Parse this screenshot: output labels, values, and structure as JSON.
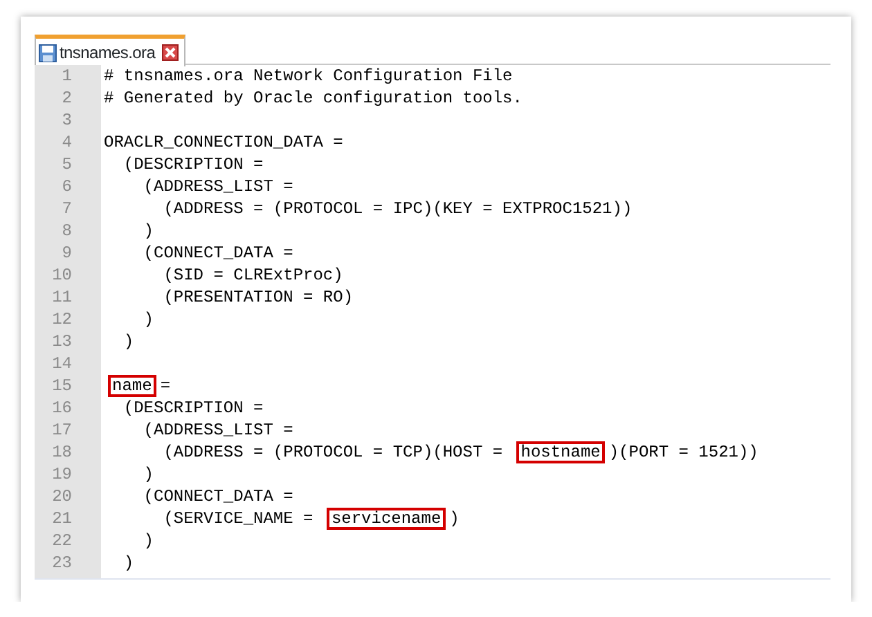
{
  "tabs": [
    {
      "label": "tnsnames.ora",
      "selected": true
    }
  ],
  "lines": [
    {
      "number": "1",
      "segments": [
        {
          "text": "# tnsnames.ora Network Configuration File",
          "boxed": false
        }
      ]
    },
    {
      "number": "2",
      "segments": [
        {
          "text": "# Generated by Oracle configuration tools.",
          "boxed": false
        }
      ]
    },
    {
      "number": "3"
    },
    {
      "number": "4",
      "segments": [
        {
          "text": "ORACLR_CONNECTION_DATA =",
          "boxed": false
        }
      ]
    },
    {
      "number": "5",
      "segments": [
        {
          "text": "  (DESCRIPTION =",
          "boxed": false
        }
      ]
    },
    {
      "number": "6",
      "segments": [
        {
          "text": "    (ADDRESS_LIST =",
          "boxed": false
        }
      ]
    },
    {
      "number": "7",
      "segments": [
        {
          "text": "      (ADDRESS = (PROTOCOL = IPC)(KEY = EXTPROC1521))",
          "boxed": false
        }
      ]
    },
    {
      "number": "8",
      "segments": [
        {
          "text": "    )",
          "boxed": false
        }
      ]
    },
    {
      "number": "9",
      "segments": [
        {
          "text": "    (CONNECT_DATA =",
          "boxed": false
        }
      ]
    },
    {
      "number": "10",
      "segments": [
        {
          "text": "      (SID = CLRExtProc)",
          "boxed": false
        }
      ]
    },
    {
      "number": "11",
      "segments": [
        {
          "text": "      (PRESENTATION = RO)",
          "boxed": false
        }
      ]
    },
    {
      "number": "12",
      "segments": [
        {
          "text": "    )",
          "boxed": false
        }
      ]
    },
    {
      "number": "13",
      "segments": [
        {
          "text": "  )",
          "boxed": false
        }
      ]
    },
    {
      "number": "14"
    },
    {
      "number": "15",
      "segments": [
        {
          "text": "name",
          "boxed": true
        },
        {
          "text": "=",
          "boxed": false
        }
      ]
    },
    {
      "number": "16",
      "segments": [
        {
          "text": "  (DESCRIPTION =",
          "boxed": false
        }
      ]
    },
    {
      "number": "17",
      "segments": [
        {
          "text": "    (ADDRESS_LIST =",
          "boxed": false
        }
      ]
    },
    {
      "number": "18",
      "segments": [
        {
          "text": "      (ADDRESS = (PROTOCOL = TCP)(HOST = ",
          "boxed": false
        },
        {
          "text": "hostname",
          "boxed": true
        },
        {
          "text": ")(PORT = 1521))",
          "boxed": false
        }
      ]
    },
    {
      "number": "19",
      "segments": [
        {
          "text": "    )",
          "boxed": false
        }
      ]
    },
    {
      "number": "20",
      "segments": [
        {
          "text": "    (CONNECT_DATA =",
          "boxed": false
        }
      ]
    },
    {
      "number": "21",
      "segments": [
        {
          "text": "      (SERVICE_NAME = ",
          "boxed": false
        },
        {
          "text": "servicename",
          "boxed": true
        },
        {
          "text": ")",
          "boxed": false
        }
      ]
    },
    {
      "number": "22",
      "segments": [
        {
          "text": "    )",
          "boxed": false
        }
      ]
    },
    {
      "number": "23",
      "segments": [
        {
          "text": "  )",
          "boxed": false
        }
      ]
    }
  ]
}
